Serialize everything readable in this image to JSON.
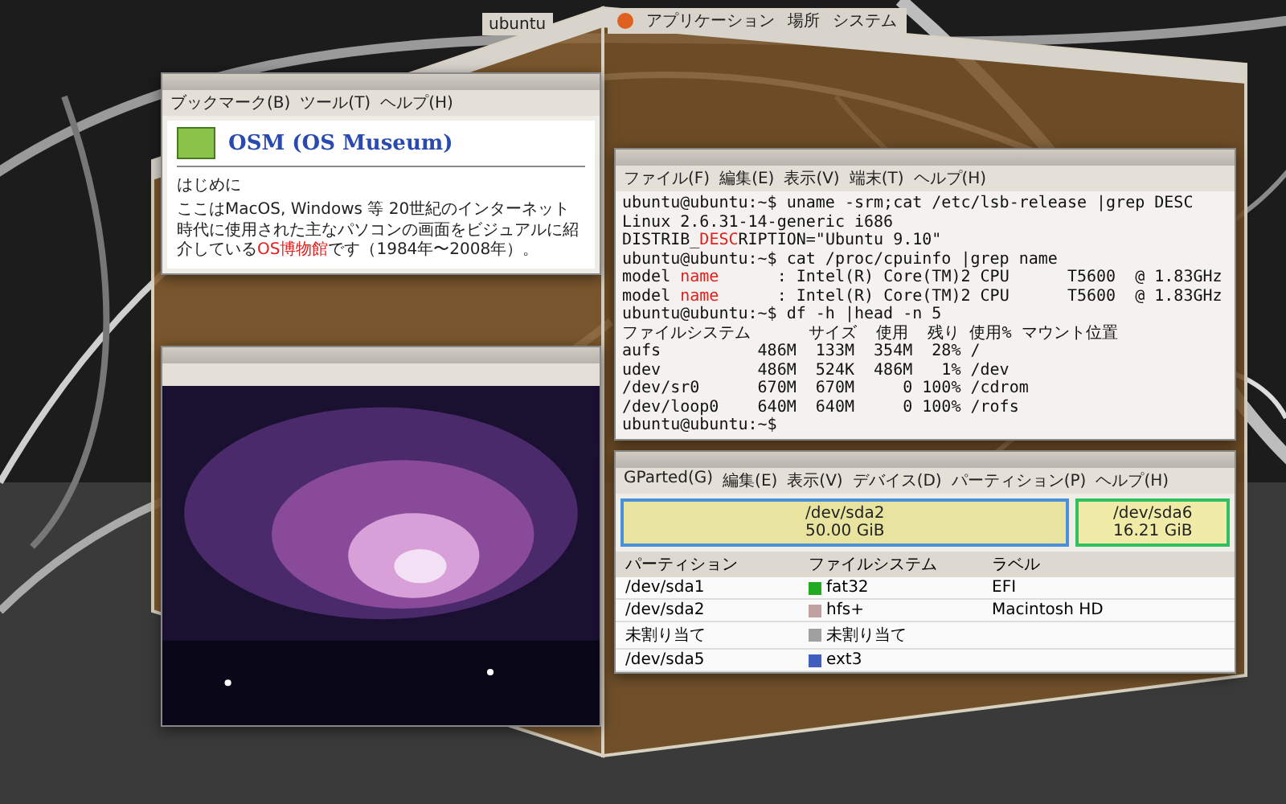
{
  "left_face": {
    "top_panel": {
      "label": "ubuntu"
    },
    "browser": {
      "menu": [
        "ブックマーク(B)",
        "ツール(T)",
        "ヘルプ(H)"
      ],
      "site_title": "OSM (OS Museum)",
      "section": "はじめに",
      "paragraph": [
        {
          "text": "ここはMacOS, Windows 等 20世紀のインターネット時代に使用された主なパソコンの画面をビジュアルに紹介している",
          "highlight": false
        },
        {
          "text": "OS博物館",
          "highlight": true
        },
        {
          "text": "です（1984年〜2008年）。",
          "highlight": false
        }
      ]
    }
  },
  "right_face": {
    "top_panel": {
      "menu": [
        "アプリケーション",
        "場所",
        "システム"
      ]
    },
    "terminal": {
      "menu": [
        "ファイル(F)",
        "編集(E)",
        "表示(V)",
        "端末(T)",
        "ヘルプ(H)"
      ],
      "lines": [
        [
          {
            "text": "ubuntu@ubuntu:~$ uname -srm;cat /etc/lsb-release |grep DESC",
            "highlight": false
          }
        ],
        [
          {
            "text": "Linux 2.6.31-14-generic i686",
            "highlight": false
          }
        ],
        [
          {
            "text": "DISTRIB_",
            "highlight": false
          },
          {
            "text": "DESC",
            "highlight": true
          },
          {
            "text": "RIPTION=\"Ubuntu 9.10\"",
            "highlight": false
          }
        ],
        [
          {
            "text": "ubuntu@ubuntu:~$ cat /proc/cpuinfo |grep name",
            "highlight": false
          }
        ],
        [
          {
            "text": "model ",
            "highlight": false
          },
          {
            "text": "name",
            "highlight": true
          },
          {
            "text": "      : Intel(R) Core(TM)2 CPU      T5600  @ 1.83GHz",
            "highlight": false
          }
        ],
        [
          {
            "text": "model ",
            "highlight": false
          },
          {
            "text": "name",
            "highlight": true
          },
          {
            "text": "      : Intel(R) Core(TM)2 CPU      T5600  @ 1.83GHz",
            "highlight": false
          }
        ],
        [
          {
            "text": "ubuntu@ubuntu:~$ df -h |head -n 5",
            "highlight": false
          }
        ],
        [
          {
            "text": "ファイルシステム      サイズ  使用  残り 使用% マウント位置",
            "highlight": false
          }
        ],
        [
          {
            "text": "aufs          486M  133M  354M  28% /",
            "highlight": false
          }
        ],
        [
          {
            "text": "udev          486M  524K  486M   1% /dev",
            "highlight": false
          }
        ],
        [
          {
            "text": "/dev/sr0      670M  670M     0 100% /cdrom",
            "highlight": false
          }
        ],
        [
          {
            "text": "/dev/loop0    640M  640M     0 100% /rofs",
            "highlight": false
          }
        ],
        [
          {
            "text": "ubuntu@ubuntu:~$ ",
            "highlight": false
          }
        ]
      ]
    },
    "gparted": {
      "menu": [
        "GParted(G)",
        "編集(E)",
        "表示(V)",
        "デバイス(D)",
        "パーティション(P)",
        "ヘルプ(H)"
      ],
      "segments": [
        {
          "name": "/dev/sda2",
          "size": "50.00 GiB",
          "selected": false
        },
        {
          "name": "/dev/sda6",
          "size": "16.21 GiB",
          "selected": true
        }
      ],
      "columns": [
        "パーティション",
        "ファイルシステム",
        "ラベル"
      ],
      "rows": [
        {
          "partition": "/dev/sda1",
          "filesystem": "fat32",
          "label": "EFI",
          "color": "#22aa22"
        },
        {
          "partition": "/dev/sda2",
          "filesystem": "hfs+",
          "label": "Macintosh HD",
          "color": "#c0a0a0"
        },
        {
          "partition": "未割り当て",
          "filesystem": "未割り当て",
          "label": "",
          "color": "#a0a0a0"
        },
        {
          "partition": "/dev/sda5",
          "filesystem": "ext3",
          "label": "",
          "color": "#4060c0"
        }
      ]
    }
  }
}
